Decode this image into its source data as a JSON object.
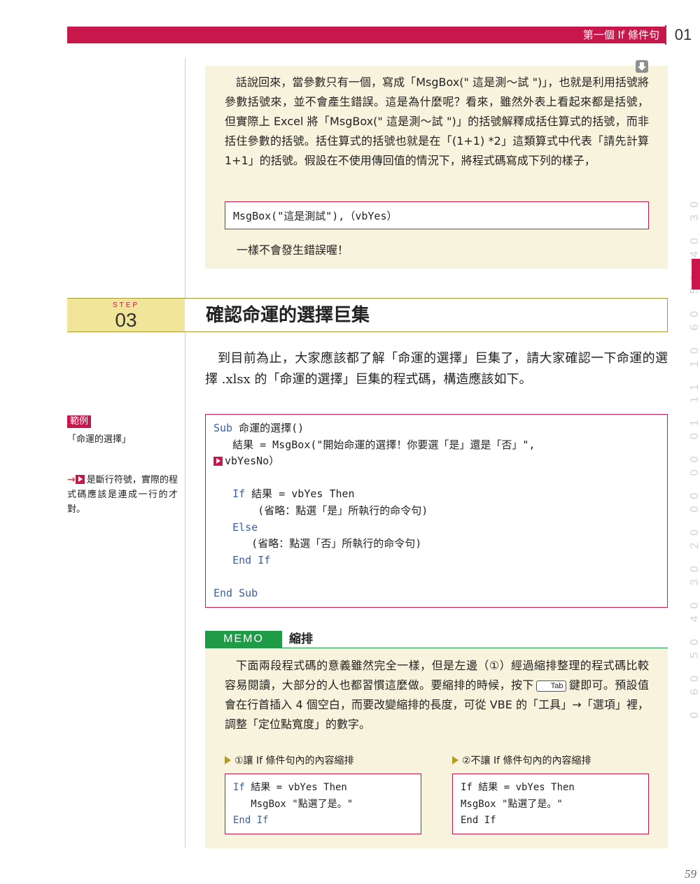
{
  "header": {
    "title": "第一個 If 條件句",
    "chapter": "01"
  },
  "note": {
    "paragraph": "話說回來，當參數只有一個，寫成「MsgBox(\" 這是測～試 \")」，也就是利用括號將參數括號來，並不會產生錯誤。這是為什麼呢？看來，雖然外表上看起來都是括號，但實際上 Excel 將「MsgBox(\" 這是測～試 \")」的括號解釋成括住算式的括號，而非括住參數的括號。括住算式的括號也就是在「(1+1) *2」這類算式中代表「請先計算 1+1」的括號。假設在不使用傳回值的情況下，將程式碼寫成下列的樣子，",
    "code": "MsgBox(\"這是測試\"),（vbYes）",
    "footer": "一樣不會發生錯誤喔！"
  },
  "side_deco": "10 60 50 40 30 20 00 00 01 11 10 60 50 40 30",
  "step": {
    "label": "STEP",
    "number": "03",
    "title": "確認命運的選擇巨集"
  },
  "intro": "到目前為止，大家應該都了解「命運的選擇」巨集了，請大家確認一下命運的選擇 .xlsx 的「命運的選擇」巨集的程式碼，構造應該如下。",
  "sidebar": {
    "tag": "範例",
    "name": "「命運的選擇」",
    "note_arrow": "→",
    "note": "是斷行符號，實際的程式碼應該是連成一行的才對。"
  },
  "main_code": {
    "l1_kw": "Sub",
    "l1_rest": " 命運的選擇()",
    "l2": "   結果 = MsgBox(\"開始命運的選擇！你要選「是」還是「否」\",",
    "l3": "vbYesNo）",
    "l5_kw": "If",
    "l5_rest": " 結果 = vbYes Then",
    "l6": "       (省略：點選「是」所執行的命令句)",
    "l7_kw": "Else",
    "l8": "      (省略：點選「否」所執行的命令句)",
    "l9_kw": "End If",
    "l11_kw": "End Sub"
  },
  "memo": {
    "tag": "MEMO",
    "title": "縮排",
    "para_before_key": "下面兩段程式碼的意義雖然完全一樣，但是左邊（①）經過縮排整理的程式碼比較容易閱讀，大部分的人也都習慣這麼做。要縮排的時候，按下",
    "key": "Tab",
    "para_after_key": "鍵即可。預設值會在行首插入 4 個空白，而要改變縮排的長度，可從 VBE 的「工具」→「選項」裡，調整「定位點寬度」的數字。"
  },
  "example_left": {
    "heading": "①讓 If 條件句內的內容縮排",
    "l1_kw": "If",
    "l1_rest": " 結果 = vbYes Then",
    "l2": "   MsgBox \"點選了是。\"",
    "l3_kw": "End If"
  },
  "example_right": {
    "heading": "②不讓 If 條件句內的內容縮排",
    "l1": "If 結果 = vbYes Then",
    "l2": "MsgBox \"點選了是。\"",
    "l3": "End If"
  },
  "page_number": "59",
  "colors": {
    "accent": "#c8174b",
    "memo_green": "#1f9a46",
    "note_bg": "#f7f3dc",
    "step_bg": "#f1e59a",
    "keyword": "#3a5fa0"
  }
}
